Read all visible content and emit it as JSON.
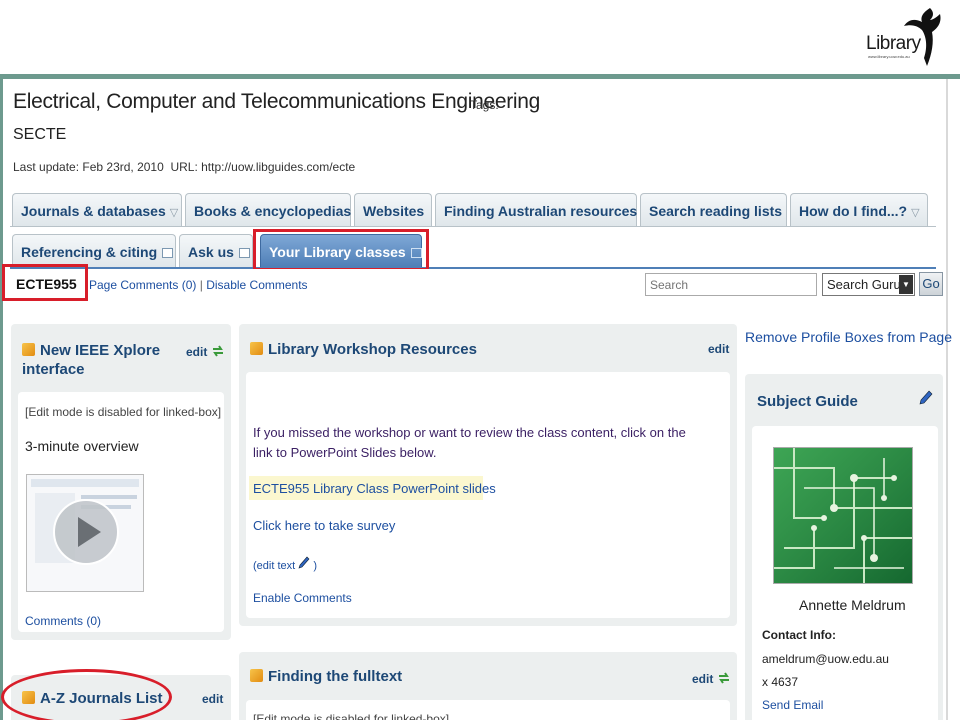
{
  "header": {
    "logo_text": "Library",
    "logo_subtext": "www.library.uow.edu.au"
  },
  "page": {
    "title": "Electrical, Computer and Telecommunications Engineering",
    "tags_label": "Tags:",
    "tag_value": "SECTE",
    "last_update": "Last update: Feb 23rd, 2010",
    "url_label": "URL: http://uow.libguides.com/ecte"
  },
  "tabs": {
    "row1": [
      {
        "label": "Journals & databases",
        "arrow": "▽"
      },
      {
        "label": "Books & encyclopedias"
      },
      {
        "label": "Websites"
      },
      {
        "label": "Finding Australian resources"
      },
      {
        "label": "Search reading lists"
      },
      {
        "label": "How do I find...?",
        "arrow": "▽"
      }
    ],
    "row2": [
      {
        "label": "Referencing & citing"
      },
      {
        "label": "Ask us"
      },
      {
        "label": "Your Library classes"
      }
    ]
  },
  "subpage": {
    "name": "ECTE955",
    "page_comments": "Page Comments (0)",
    "separator": "|",
    "disable_comments": "Disable Comments"
  },
  "search": {
    "placeholder": "Search",
    "scope": "Search Guru",
    "go_label": "Go"
  },
  "left_boxes": {
    "ieee": {
      "title": "New IEEE Xplore interface",
      "edit_label": "edit",
      "disabled_note": "[Edit mode is disabled for linked-box]",
      "video_title": "3-minute overview",
      "comments": "Comments (0)"
    },
    "az": {
      "title": "A-Z Journals List",
      "edit_label": "edit"
    }
  },
  "center_boxes": {
    "workshop": {
      "title": "Library Workshop Resources",
      "edit_label": "edit",
      "intro": "If you missed the workshop or want to review the class content, click on the link to PowerPoint Slides below.",
      "slides_link": "ECTE955 Library Class PowerPoint slides",
      "survey_link": "Click here to take survey",
      "edit_text_open": "(edit text",
      "edit_text_close": ")",
      "enable_comments": "Enable Comments"
    },
    "fulltext": {
      "title": "Finding the fulltext",
      "edit_label": "edit",
      "disabled_note": "[Edit mode is disabled for linked-box]"
    }
  },
  "right_column": {
    "remove_boxes": "Remove Profile Boxes from Page",
    "subject_guide": {
      "title": "Subject Guide",
      "name": "Annette Meldrum",
      "contact_label": "Contact Info:",
      "email": "ameldrum@uow.edu.au",
      "phone": "x 4637",
      "send_email": "Send Email"
    }
  },
  "colors": {
    "accent_teal": "#6d9a8e",
    "tab_text": "#1d4876",
    "link_blue": "#1d4fa0",
    "highlight_red": "#d81e2a",
    "active_tab": "#4f7fb7"
  }
}
